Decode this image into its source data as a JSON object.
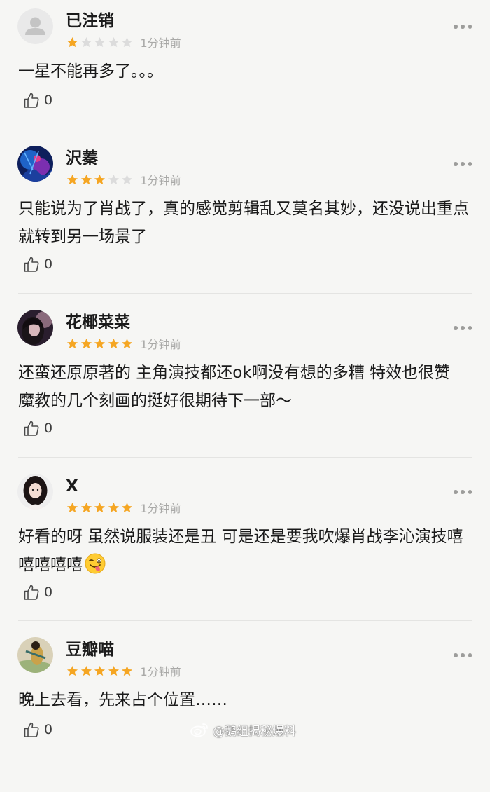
{
  "colors": {
    "background": "#f6f6f4",
    "star_filled": "#f5a623",
    "star_empty": "#dcdcdc",
    "meta_gray": "#a9a9a7"
  },
  "comments": [
    {
      "username": "已注销",
      "stars": 1,
      "time": "1分钟前",
      "text": "一星不能再多了。。。",
      "likes": "0",
      "avatar": "default-avatar-icon"
    },
    {
      "username": "沢蓁",
      "stars": 3,
      "time": "1分钟前",
      "text": "只能说为了肖战了，真的感觉剪辑乱又莫名其妙，还没说出重点就转到另一场景了",
      "likes": "0",
      "avatar": "blue-abstract-avatar"
    },
    {
      "username": "花椰菜菜",
      "stars": 5,
      "time": "1分钟前",
      "text": "还蛮还原原著的 主角演技都还ok啊没有想的多糟 特效也很赞 魔教的几个刻画的挺好很期待下一部～",
      "likes": "0",
      "avatar": "dark-portrait-avatar"
    },
    {
      "username": "X",
      "stars": 5,
      "time": "1分钟前",
      "text": "好看的呀 虽然说服装还是丑 可是还是要我吹爆肖战李沁演技嘻嘻嘻嘻嘻",
      "likes": "0",
      "avatar": "girl-portrait-avatar",
      "emoji": "winking-tongue-emoji"
    },
    {
      "username": "豆瓣喵",
      "stars": 5,
      "time": "1分钟前",
      "text": "晚上去看，先来占个位置……",
      "likes": "0",
      "avatar": "illustration-avatar"
    }
  ],
  "watermark": {
    "text": "@鹅组揭秘爆料",
    "icon": "weibo-logo-icon"
  }
}
